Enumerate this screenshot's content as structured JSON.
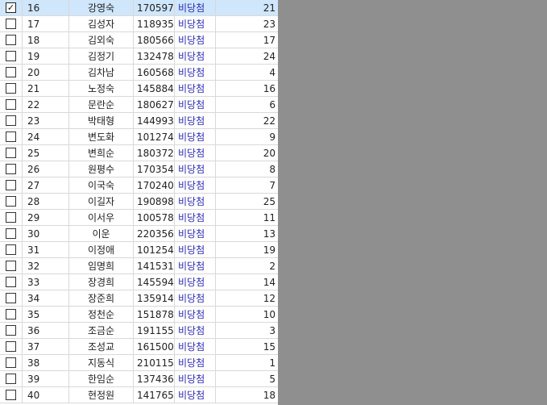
{
  "rows": [
    {
      "checked": true,
      "no": "16",
      "name": "강영숙",
      "code": "170597",
      "result": "비당첨",
      "count": "21"
    },
    {
      "checked": false,
      "no": "17",
      "name": "김성자",
      "code": "118935",
      "result": "비당첨",
      "count": "23"
    },
    {
      "checked": false,
      "no": "18",
      "name": "김외숙",
      "code": "180566",
      "result": "비당첨",
      "count": "17"
    },
    {
      "checked": false,
      "no": "19",
      "name": "김정기",
      "code": "132478",
      "result": "비당첨",
      "count": "24"
    },
    {
      "checked": false,
      "no": "20",
      "name": "김차남",
      "code": "160568",
      "result": "비당첨",
      "count": "4"
    },
    {
      "checked": false,
      "no": "21",
      "name": "노정숙",
      "code": "145884",
      "result": "비당첨",
      "count": "16"
    },
    {
      "checked": false,
      "no": "22",
      "name": "문란순",
      "code": "180627",
      "result": "비당첨",
      "count": "6"
    },
    {
      "checked": false,
      "no": "23",
      "name": "박태형",
      "code": "144993",
      "result": "비당첨",
      "count": "22"
    },
    {
      "checked": false,
      "no": "24",
      "name": "변도화",
      "code": "101274",
      "result": "비당첨",
      "count": "9"
    },
    {
      "checked": false,
      "no": "25",
      "name": "변희순",
      "code": "180372",
      "result": "비당첨",
      "count": "20"
    },
    {
      "checked": false,
      "no": "26",
      "name": "원평수",
      "code": "170354",
      "result": "비당첨",
      "count": "8"
    },
    {
      "checked": false,
      "no": "27",
      "name": "이국숙",
      "code": "170240",
      "result": "비당첨",
      "count": "7"
    },
    {
      "checked": false,
      "no": "28",
      "name": "이길자",
      "code": "190898",
      "result": "비당첨",
      "count": "25"
    },
    {
      "checked": false,
      "no": "29",
      "name": "이서우",
      "code": "100578",
      "result": "비당첨",
      "count": "11"
    },
    {
      "checked": false,
      "no": "30",
      "name": "이운",
      "code": "220356",
      "result": "비당첨",
      "count": "13"
    },
    {
      "checked": false,
      "no": "31",
      "name": "이정애",
      "code": "101254",
      "result": "비당첨",
      "count": "19"
    },
    {
      "checked": false,
      "no": "32",
      "name": "임명희",
      "code": "141531",
      "result": "비당첨",
      "count": "2"
    },
    {
      "checked": false,
      "no": "33",
      "name": "장경희",
      "code": "145594",
      "result": "비당첨",
      "count": "14"
    },
    {
      "checked": false,
      "no": "34",
      "name": "장준희",
      "code": "135914",
      "result": "비당첨",
      "count": "12"
    },
    {
      "checked": false,
      "no": "35",
      "name": "정천순",
      "code": "151878",
      "result": "비당첨",
      "count": "10"
    },
    {
      "checked": false,
      "no": "36",
      "name": "조금순",
      "code": "191155",
      "result": "비당첨",
      "count": "3"
    },
    {
      "checked": false,
      "no": "37",
      "name": "조성교",
      "code": "161500",
      "result": "비당첨",
      "count": "15"
    },
    {
      "checked": false,
      "no": "38",
      "name": "지동식",
      "code": "210115",
      "result": "비당첨",
      "count": "1"
    },
    {
      "checked": false,
      "no": "39",
      "name": "한임순",
      "code": "137436",
      "result": "비당첨",
      "count": "5"
    },
    {
      "checked": false,
      "no": "40",
      "name": "현정원",
      "code": "141765",
      "result": "비당첨",
      "count": "18"
    }
  ],
  "check_glyph": "✓"
}
